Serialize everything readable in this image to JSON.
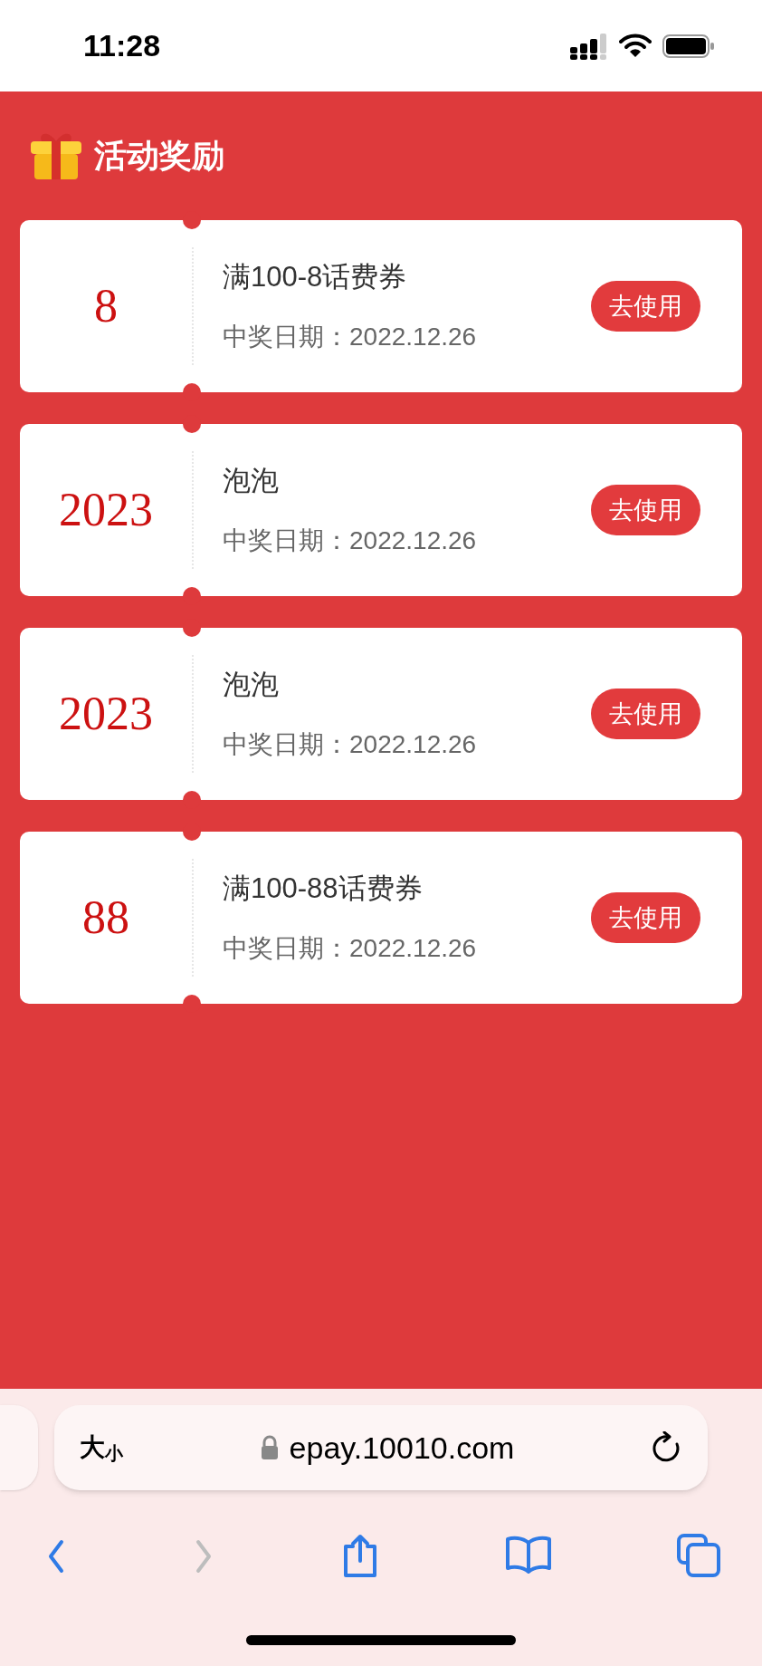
{
  "status_bar": {
    "time": "11:28"
  },
  "header": {
    "title": "活动奖励"
  },
  "rewards": [
    {
      "value": "8",
      "title": "满100-8话费券",
      "date": "中奖日期：2022.12.26",
      "button": "去使用"
    },
    {
      "value": "2023",
      "title": "泡泡",
      "date": "中奖日期：2022.12.26",
      "button": "去使用"
    },
    {
      "value": "2023",
      "title": "泡泡",
      "date": "中奖日期：2022.12.26",
      "button": "去使用"
    },
    {
      "value": "88",
      "title": "满100-88话费券",
      "date": "中奖日期：2022.12.26",
      "button": "去使用"
    }
  ],
  "address_bar": {
    "size_button": "大小",
    "url": "epay.10010.com"
  },
  "toolbar": [
    {
      "kind": "back",
      "disabled": false
    },
    {
      "kind": "forward",
      "disabled": true
    },
    {
      "kind": "share",
      "disabled": false
    },
    {
      "kind": "bookmarks",
      "disabled": false
    },
    {
      "kind": "tabs",
      "disabled": false
    }
  ]
}
